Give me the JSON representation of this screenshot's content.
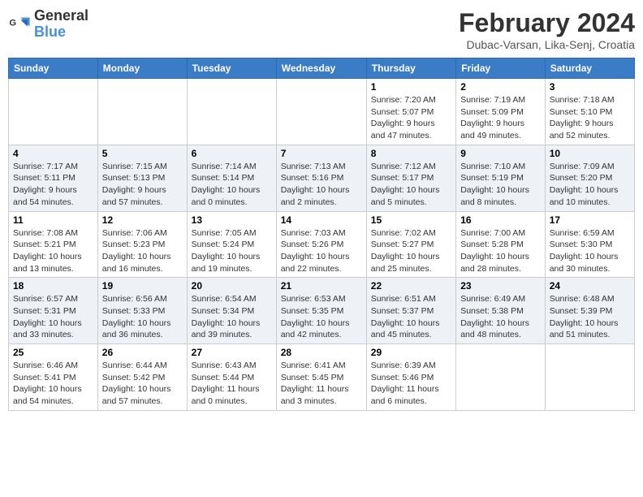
{
  "header": {
    "logo_line1": "General",
    "logo_line2": "Blue",
    "month_year": "February 2024",
    "location": "Dubac-Varsan, Lika-Senj, Croatia"
  },
  "weekdays": [
    "Sunday",
    "Monday",
    "Tuesday",
    "Wednesday",
    "Thursday",
    "Friday",
    "Saturday"
  ],
  "weeks": [
    [
      {
        "day": "",
        "info": ""
      },
      {
        "day": "",
        "info": ""
      },
      {
        "day": "",
        "info": ""
      },
      {
        "day": "",
        "info": ""
      },
      {
        "day": "1",
        "info": "Sunrise: 7:20 AM\nSunset: 5:07 PM\nDaylight: 9 hours\nand 47 minutes."
      },
      {
        "day": "2",
        "info": "Sunrise: 7:19 AM\nSunset: 5:09 PM\nDaylight: 9 hours\nand 49 minutes."
      },
      {
        "day": "3",
        "info": "Sunrise: 7:18 AM\nSunset: 5:10 PM\nDaylight: 9 hours\nand 52 minutes."
      }
    ],
    [
      {
        "day": "4",
        "info": "Sunrise: 7:17 AM\nSunset: 5:11 PM\nDaylight: 9 hours\nand 54 minutes."
      },
      {
        "day": "5",
        "info": "Sunrise: 7:15 AM\nSunset: 5:13 PM\nDaylight: 9 hours\nand 57 minutes."
      },
      {
        "day": "6",
        "info": "Sunrise: 7:14 AM\nSunset: 5:14 PM\nDaylight: 10 hours\nand 0 minutes."
      },
      {
        "day": "7",
        "info": "Sunrise: 7:13 AM\nSunset: 5:16 PM\nDaylight: 10 hours\nand 2 minutes."
      },
      {
        "day": "8",
        "info": "Sunrise: 7:12 AM\nSunset: 5:17 PM\nDaylight: 10 hours\nand 5 minutes."
      },
      {
        "day": "9",
        "info": "Sunrise: 7:10 AM\nSunset: 5:19 PM\nDaylight: 10 hours\nand 8 minutes."
      },
      {
        "day": "10",
        "info": "Sunrise: 7:09 AM\nSunset: 5:20 PM\nDaylight: 10 hours\nand 10 minutes."
      }
    ],
    [
      {
        "day": "11",
        "info": "Sunrise: 7:08 AM\nSunset: 5:21 PM\nDaylight: 10 hours\nand 13 minutes."
      },
      {
        "day": "12",
        "info": "Sunrise: 7:06 AM\nSunset: 5:23 PM\nDaylight: 10 hours\nand 16 minutes."
      },
      {
        "day": "13",
        "info": "Sunrise: 7:05 AM\nSunset: 5:24 PM\nDaylight: 10 hours\nand 19 minutes."
      },
      {
        "day": "14",
        "info": "Sunrise: 7:03 AM\nSunset: 5:26 PM\nDaylight: 10 hours\nand 22 minutes."
      },
      {
        "day": "15",
        "info": "Sunrise: 7:02 AM\nSunset: 5:27 PM\nDaylight: 10 hours\nand 25 minutes."
      },
      {
        "day": "16",
        "info": "Sunrise: 7:00 AM\nSunset: 5:28 PM\nDaylight: 10 hours\nand 28 minutes."
      },
      {
        "day": "17",
        "info": "Sunrise: 6:59 AM\nSunset: 5:30 PM\nDaylight: 10 hours\nand 30 minutes."
      }
    ],
    [
      {
        "day": "18",
        "info": "Sunrise: 6:57 AM\nSunset: 5:31 PM\nDaylight: 10 hours\nand 33 minutes."
      },
      {
        "day": "19",
        "info": "Sunrise: 6:56 AM\nSunset: 5:33 PM\nDaylight: 10 hours\nand 36 minutes."
      },
      {
        "day": "20",
        "info": "Sunrise: 6:54 AM\nSunset: 5:34 PM\nDaylight: 10 hours\nand 39 minutes."
      },
      {
        "day": "21",
        "info": "Sunrise: 6:53 AM\nSunset: 5:35 PM\nDaylight: 10 hours\nand 42 minutes."
      },
      {
        "day": "22",
        "info": "Sunrise: 6:51 AM\nSunset: 5:37 PM\nDaylight: 10 hours\nand 45 minutes."
      },
      {
        "day": "23",
        "info": "Sunrise: 6:49 AM\nSunset: 5:38 PM\nDaylight: 10 hours\nand 48 minutes."
      },
      {
        "day": "24",
        "info": "Sunrise: 6:48 AM\nSunset: 5:39 PM\nDaylight: 10 hours\nand 51 minutes."
      }
    ],
    [
      {
        "day": "25",
        "info": "Sunrise: 6:46 AM\nSunset: 5:41 PM\nDaylight: 10 hours\nand 54 minutes."
      },
      {
        "day": "26",
        "info": "Sunrise: 6:44 AM\nSunset: 5:42 PM\nDaylight: 10 hours\nand 57 minutes."
      },
      {
        "day": "27",
        "info": "Sunrise: 6:43 AM\nSunset: 5:44 PM\nDaylight: 11 hours\nand 0 minutes."
      },
      {
        "day": "28",
        "info": "Sunrise: 6:41 AM\nSunset: 5:45 PM\nDaylight: 11 hours\nand 3 minutes."
      },
      {
        "day": "29",
        "info": "Sunrise: 6:39 AM\nSunset: 5:46 PM\nDaylight: 11 hours\nand 6 minutes."
      },
      {
        "day": "",
        "info": ""
      },
      {
        "day": "",
        "info": ""
      }
    ]
  ]
}
